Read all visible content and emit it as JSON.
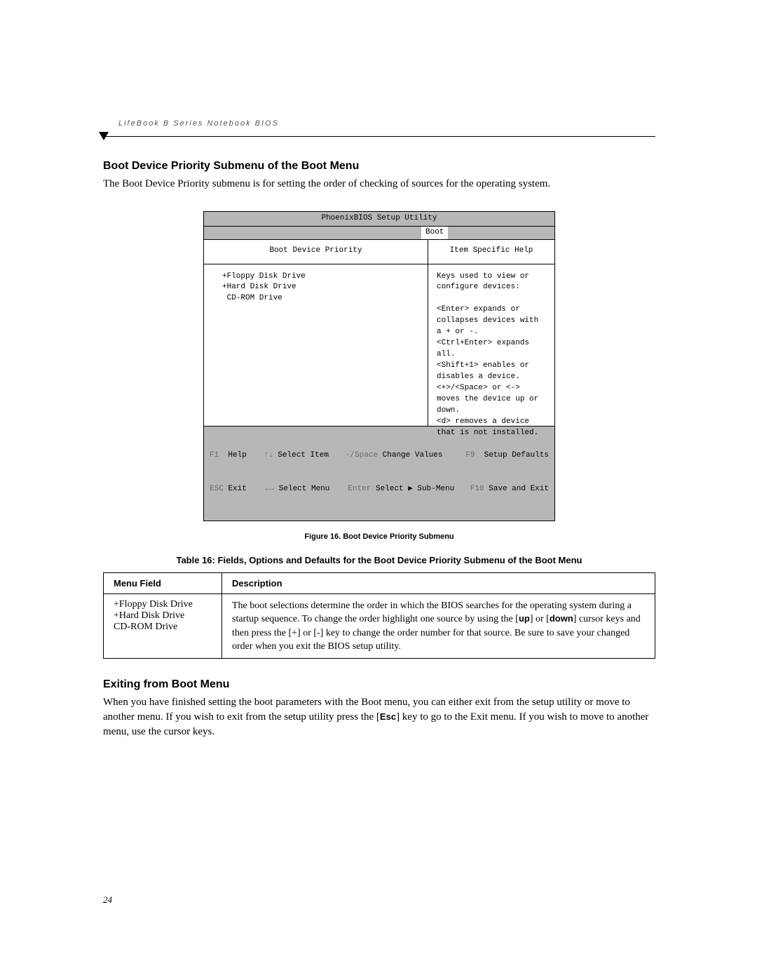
{
  "runningHead": "LifeBook B Series Notebook BIOS",
  "section1": {
    "heading": "Boot Device Priority Submenu of the Boot Menu",
    "intro": "The Boot Device Priority submenu is for setting the order of checking of sources for the operating system."
  },
  "bios": {
    "title": "PhoenixBIOS Setup Utility",
    "activeMenu": "Boot",
    "leftHeader": "Boot Device Priority",
    "rightHeader": "Item Specific Help",
    "devices": "+Floppy Disk Drive\n+Hard Disk Drive\n CD-ROM Drive",
    "help": "Keys used to view or\nconfigure devices:\n\n<Enter> expands or\ncollapses devices with\na + or -.\n<Ctrl+Enter> expands\nall.\n<Shift+1> enables or\ndisables a device.\n<+>/<Space> or <->\nmoves the device up or\ndown.\n<d> removes a device\nthat is not installed.",
    "footer": {
      "r1": {
        "k1": "F1",
        "l1": "Help",
        "k2": "↑↓",
        "l2": "Select Item",
        "k3": "-/Space",
        "l3": "Change Values",
        "k4": "F9",
        "l4": "Setup Defaults"
      },
      "r2": {
        "k1": "ESC",
        "l1": "Exit",
        "k2": "←→",
        "l2": "Select Menu",
        "k3": "Enter",
        "l3": "Select ▶ Sub-Menu",
        "k4": "F10",
        "l4": "Save and Exit"
      }
    }
  },
  "figureCaption": "Figure 16.  Boot Device Priority Submenu",
  "tableTitle": "Table 16: Fields, Options and Defaults for the Boot Device Priority Submenu of the Boot Menu",
  "table": {
    "head": {
      "c1": "Menu Field",
      "c2": "Description"
    },
    "row1": {
      "menu": "+Floppy Disk Drive\n+Hard Disk Drive\nCD-ROM Drive",
      "desc_pre": "The boot selections determine the order in which the BIOS searches for the operating system during a startup sequence. To change the order highlight one source by using the [",
      "up": "up",
      "desc_mid1": "] or [",
      "down": "down",
      "desc_mid2": "] cursor keys and then press the [+] or [-] key to change the order number for that source. Be sure to save your changed order when you exit the BIOS setup utility."
    }
  },
  "section2": {
    "heading": "Exiting from Boot Menu",
    "para_pre": "When you have finished setting the boot parameters with the Boot menu, you can either exit from the setup utility or move to another menu. If you wish to exit from the setup utility press the [",
    "esc": "Esc",
    "para_post": "] key to go to the Exit menu. If you wish to move to another menu, use the cursor keys."
  },
  "pageNumber": "24"
}
